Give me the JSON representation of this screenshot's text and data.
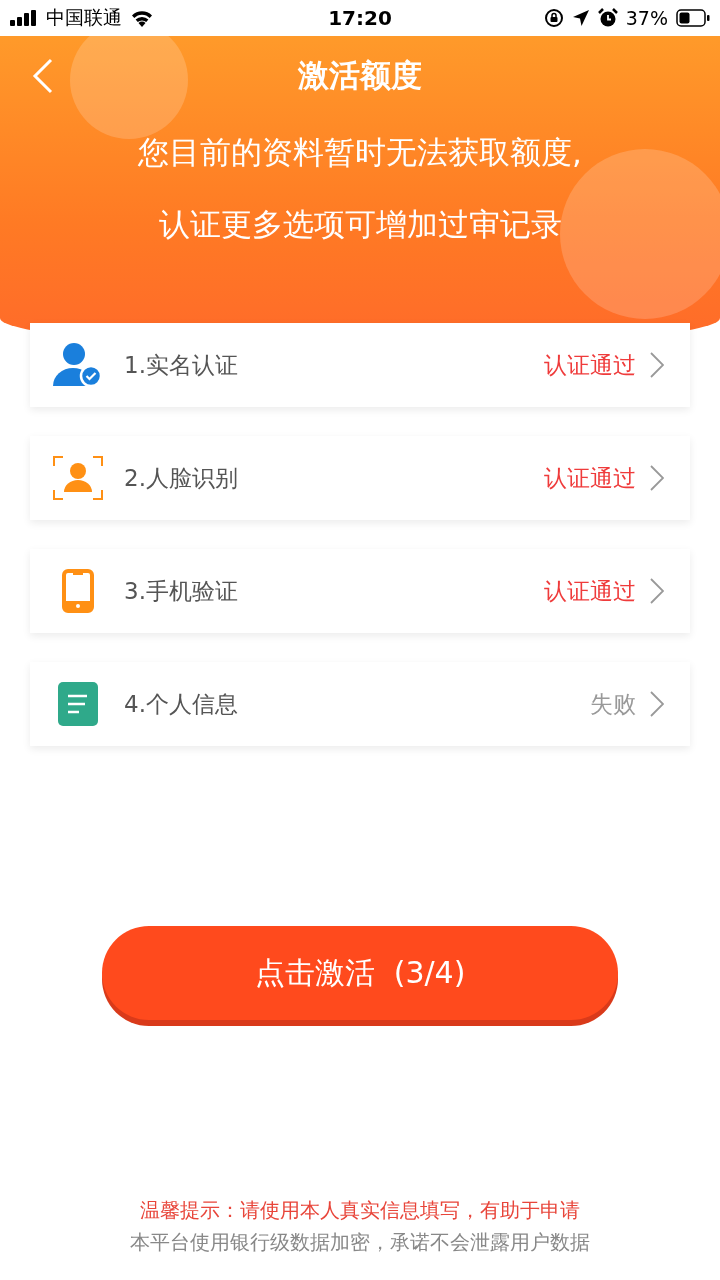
{
  "status_bar": {
    "carrier": "中国联通",
    "time": "17:20",
    "battery": "37%"
  },
  "header": {
    "title": "激活额度",
    "message": [
      "您目前的资料暂时无法获取额度,",
      "认证更多选项可增加过审记录"
    ]
  },
  "items": [
    {
      "kind": "person",
      "label": "1.实名认证",
      "status": "认证通过",
      "passed": true
    },
    {
      "kind": "face",
      "label": "2.人脸识别",
      "status": "认证通过",
      "passed": true
    },
    {
      "kind": "phone",
      "label": "3.手机验证",
      "status": "认证通过",
      "passed": true
    },
    {
      "kind": "document",
      "label": "4.个人信息",
      "status": "失败",
      "passed": false
    }
  ],
  "activate_button": {
    "label": "点击激活  (3/4)"
  },
  "footer": {
    "tip": "温馨提示：请使用本人真实信息填写，有助于申请",
    "note": "本平台使用银行级数据加密，承诺不会泄露用户数据"
  }
}
